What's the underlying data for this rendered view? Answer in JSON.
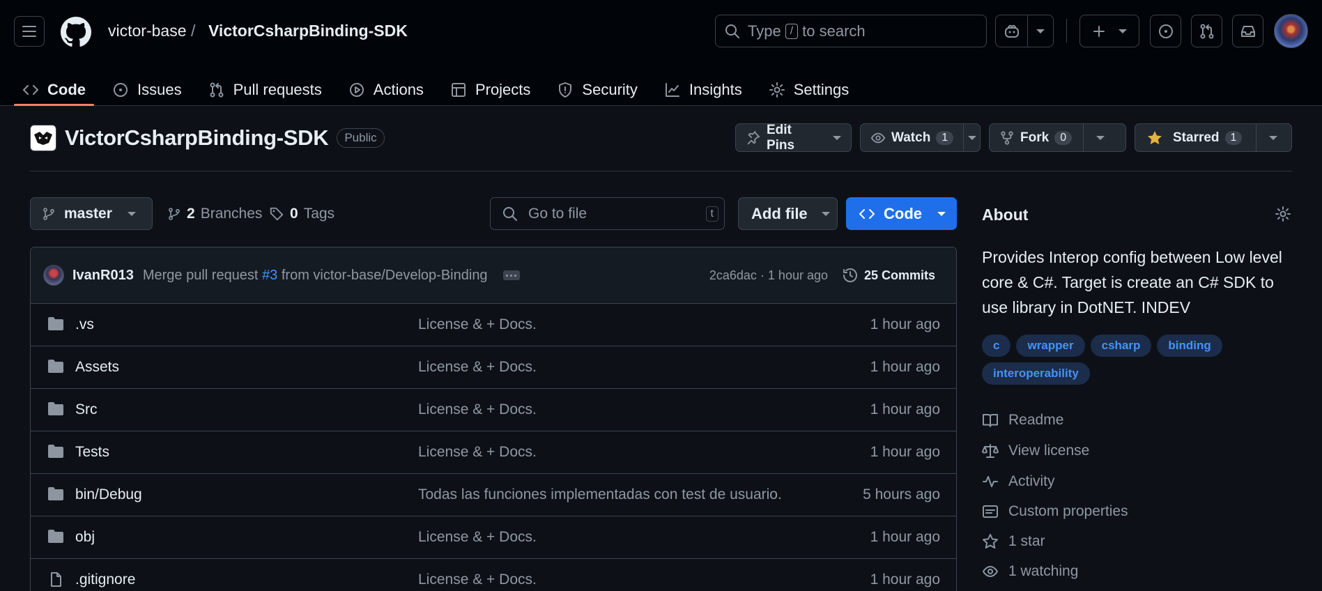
{
  "header": {
    "owner": "victor-base",
    "separator": "/",
    "repo": "VictorCsharpBinding-SDK",
    "search_prefix": "Type",
    "search_key": "/",
    "search_suffix": "to search"
  },
  "tabs": [
    {
      "label": "Code",
      "icon": "code-icon",
      "active": true
    },
    {
      "label": "Issues",
      "icon": "issue-icon"
    },
    {
      "label": "Pull requests",
      "icon": "pull-request-icon"
    },
    {
      "label": "Actions",
      "icon": "play-icon"
    },
    {
      "label": "Projects",
      "icon": "table-icon"
    },
    {
      "label": "Security",
      "icon": "shield-icon"
    },
    {
      "label": "Insights",
      "icon": "graph-icon"
    },
    {
      "label": "Settings",
      "icon": "gear-icon"
    }
  ],
  "repo": {
    "name": "VictorCsharpBinding-SDK",
    "visibility": "Public",
    "edit_pins": "Edit Pins",
    "watch": "Watch",
    "watch_count": "1",
    "fork": "Fork",
    "fork_count": "0",
    "starred": "Starred",
    "star_count": "1"
  },
  "branch": {
    "name": "master",
    "branches_count": "2",
    "branches_label": "Branches",
    "tags_count": "0",
    "tags_label": "Tags",
    "goto_placeholder": "Go to file",
    "goto_key": "t",
    "add_file": "Add file",
    "code": "Code"
  },
  "commit": {
    "user": "IvanR013",
    "message_prefix": "Merge pull request",
    "pr": "#3",
    "message_suffix": "from victor-base/Develop-Binding",
    "sha_time": "2ca6dac · 1 hour ago",
    "commits": "25 Commits"
  },
  "files": [
    {
      "name": ".vs",
      "type": "folder",
      "message": "License & + Docs.",
      "time": "1 hour ago"
    },
    {
      "name": "Assets",
      "type": "folder",
      "message": "License & + Docs.",
      "time": "1 hour ago"
    },
    {
      "name": "Src",
      "type": "folder",
      "message": "License & + Docs.",
      "time": "1 hour ago"
    },
    {
      "name": "Tests",
      "type": "folder",
      "message": "License & + Docs.",
      "time": "1 hour ago"
    },
    {
      "name": "bin/Debug",
      "type": "folder",
      "message": "Todas las funciones implementadas con test de usuario.",
      "time": "5 hours ago"
    },
    {
      "name": "obj",
      "type": "folder",
      "message": "License & + Docs.",
      "time": "1 hour ago"
    },
    {
      "name": ".gitignore",
      "type": "file",
      "message": "License & + Docs.",
      "time": "1 hour ago"
    }
  ],
  "about": {
    "title": "About",
    "description": "Provides Interop config between Low level core & C#. Target is create an C# SDK to use library in DotNET. INDEV",
    "topics": [
      "c",
      "wrapper",
      "csharp",
      "binding",
      "interoperability"
    ],
    "links": [
      {
        "label": "Readme",
        "icon": "book-icon"
      },
      {
        "label": "View license",
        "icon": "law-icon"
      },
      {
        "label": "Activity",
        "icon": "pulse-icon"
      },
      {
        "label": "Custom properties",
        "icon": "note-icon"
      },
      {
        "label": "1 star",
        "icon": "star-icon"
      },
      {
        "label": "1 watching",
        "icon": "eye-icon"
      }
    ]
  }
}
